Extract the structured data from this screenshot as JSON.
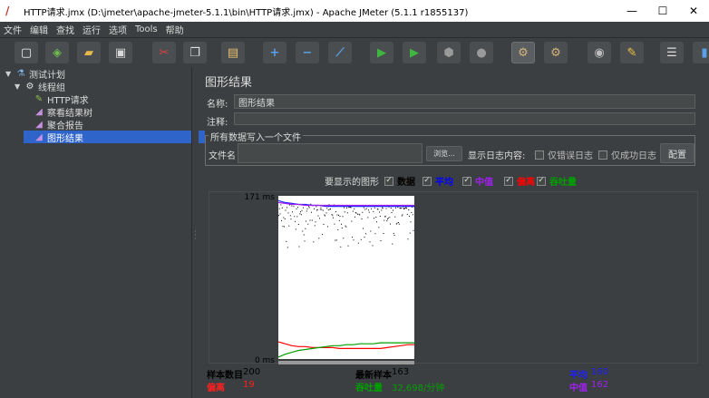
{
  "window": {
    "title": "HTTP请求.jmx (D:\\jmeter\\apache-jmeter-5.1.1\\bin\\HTTP请求.jmx) - Apache JMeter (5.1.1 r1855137)",
    "minimize": "—",
    "maximize": "☐",
    "close": "✕"
  },
  "menu": [
    "文件",
    "编辑",
    "查找",
    "运行",
    "选项",
    "Tools",
    "帮助"
  ],
  "toolbar": [
    {
      "name": "new-button",
      "glyph": "▢",
      "color": "#f0f0f0"
    },
    {
      "name": "templates-button",
      "glyph": "◈",
      "color": "#6fbf4f"
    },
    {
      "name": "open-button",
      "glyph": "▰",
      "color": "#e8b84a"
    },
    {
      "name": "save-button",
      "glyph": "▣",
      "color": "#d9d9d9"
    },
    {
      "name": "cut-button",
      "glyph": "✂",
      "color": "#e04040"
    },
    {
      "name": "copy-button",
      "glyph": "❐",
      "color": "#e0e0e0"
    },
    {
      "name": "paste-button",
      "glyph": "▤",
      "color": "#e8c070"
    },
    {
      "name": "expand-button",
      "glyph": "+",
      "color": "#5aa0e6"
    },
    {
      "name": "collapse-button",
      "glyph": "−",
      "color": "#5aa0e6"
    },
    {
      "name": "toggle-button",
      "glyph": "⟋",
      "color": "#5aa0e6"
    },
    {
      "name": "start-button",
      "glyph": "▶",
      "color": "#3fb63f"
    },
    {
      "name": "start-no-pauses-button",
      "glyph": "▶",
      "color": "#3fb63f"
    },
    {
      "name": "stop-button",
      "glyph": "⬢",
      "color": "#9a9a9a"
    },
    {
      "name": "shutdown-button",
      "glyph": "●",
      "color": "#9a9a9a"
    },
    {
      "name": "clear-button",
      "glyph": "⚙",
      "color": "#d4b47a"
    },
    {
      "name": "clear-all-button",
      "glyph": "⚙",
      "color": "#d4b47a"
    },
    {
      "name": "search-button",
      "glyph": "◉",
      "color": "#bdbdbd"
    },
    {
      "name": "reset-search-button",
      "glyph": "✎",
      "color": "#f0c040"
    },
    {
      "name": "function-helper-button",
      "glyph": "☰",
      "color": "#dcdcdc"
    },
    {
      "name": "help-button",
      "glyph": "▮",
      "color": "#5aa0e6"
    }
  ],
  "tree": [
    {
      "label": "测试计划",
      "icon": "flask-icon",
      "glyph": "⚗",
      "color": "#7fb3e6",
      "arrow": "▼",
      "indent": 0,
      "selected": false
    },
    {
      "label": "线程组",
      "icon": "gear-icon",
      "glyph": "⚙",
      "color": "#e0e0e0",
      "arrow": "▼",
      "indent": 1,
      "selected": false
    },
    {
      "label": "HTTP请求",
      "icon": "pipette-icon",
      "glyph": "✎",
      "color": "#8fbf4f",
      "arrow": "",
      "indent": 2,
      "selected": false
    },
    {
      "label": "察看结果树",
      "icon": "chart-icon",
      "glyph": "◢",
      "color": "#c890e0",
      "arrow": "",
      "indent": 2,
      "selected": false
    },
    {
      "label": "聚合报告",
      "icon": "chart-icon",
      "glyph": "◢",
      "color": "#c890e0",
      "arrow": "",
      "indent": 2,
      "selected": false
    },
    {
      "label": "图形结果",
      "icon": "chart-icon",
      "glyph": "◢",
      "color": "#c890e0",
      "arrow": "",
      "indent": 2,
      "selected": true
    }
  ],
  "panel": {
    "title": "图形结果",
    "name_label": "名称:",
    "name_value": "图形结果",
    "comment_label": "注释:",
    "comment_value": "",
    "group_title": "所有数据写入一个文件",
    "filename_label": "文件名",
    "filename_value": "",
    "browse_label": "浏览...",
    "log_label": "显示日志内容:",
    "errors_only_label": "仅错误日志",
    "success_only_label": "仅成功日志",
    "configure_label": "配置"
  },
  "graph_options": {
    "label": "要显示的图形",
    "items": [
      {
        "name": "data",
        "label": "数据",
        "color": "#000000",
        "checked": true
      },
      {
        "name": "average",
        "label": "平均",
        "color": "#0000ff",
        "checked": true
      },
      {
        "name": "median",
        "label": "中值",
        "color": "#a020f0",
        "checked": true
      },
      {
        "name": "deviation",
        "label": "偏离",
        "color": "#ff0000",
        "checked": true
      },
      {
        "name": "throughput",
        "label": "吞吐量",
        "color": "#00a000",
        "checked": true
      }
    ]
  },
  "chart_data": {
    "type": "line",
    "title": "",
    "xlabel": "",
    "ylabel": "",
    "y_max_label": "171  ms",
    "y_min_label": "0  ms",
    "ylim": [
      0,
      171
    ],
    "xlim": [
      0,
      200
    ],
    "grid": false,
    "series": [
      {
        "name": "平均",
        "color": "#2020ff",
        "x": [
          0,
          10,
          20,
          30,
          40,
          50,
          60,
          70,
          80,
          90,
          100,
          110,
          120,
          130,
          140,
          150,
          160,
          170,
          180,
          190,
          200
        ],
        "y": [
          166,
          164,
          163,
          162,
          162,
          161,
          161,
          160,
          160,
          160,
          160,
          160,
          160,
          160,
          160,
          160,
          160,
          160,
          160,
          160,
          160
        ]
      },
      {
        "name": "中值",
        "color": "#a020f0",
        "x": [
          0,
          10,
          20,
          30,
          40,
          50,
          60,
          70,
          80,
          90,
          100,
          110,
          120,
          130,
          140,
          150,
          160,
          170,
          180,
          190,
          200
        ],
        "y": [
          164,
          163,
          162,
          162,
          161,
          161,
          161,
          161,
          161,
          161,
          161,
          161,
          161,
          161,
          161,
          161,
          161,
          161,
          161,
          161,
          161
        ]
      },
      {
        "name": "偏离",
        "color": "#ff0000",
        "x": [
          0,
          10,
          20,
          30,
          40,
          50,
          60,
          70,
          80,
          90,
          100,
          110,
          120,
          130,
          140,
          150,
          160,
          170,
          180,
          190,
          200
        ],
        "y": [
          18,
          16,
          14,
          13,
          13,
          12,
          12,
          12,
          12,
          11,
          11,
          11,
          11,
          11,
          11,
          11,
          12,
          13,
          14,
          15,
          15
        ]
      },
      {
        "name": "吞吐量",
        "color": "#00a000",
        "x": [
          0,
          10,
          20,
          30,
          40,
          50,
          60,
          70,
          80,
          90,
          100,
          110,
          120,
          130,
          140,
          150,
          160,
          170,
          180,
          190,
          200
        ],
        "y": [
          2,
          5,
          7,
          9,
          10,
          11,
          12,
          13,
          14,
          14,
          15,
          15,
          16,
          16,
          16,
          17,
          17,
          17,
          17,
          17,
          17
        ]
      }
    ]
  },
  "stats": {
    "samples_label": "样本数目",
    "samples_value": "200",
    "latest_label": "最新样本",
    "latest_value": "163",
    "average_label": "平均",
    "average_value": "160",
    "deviation_label": "偏离",
    "deviation_value": "19",
    "throughput_label": "吞吐量",
    "throughput_value": "32,698/分钟",
    "median_label": "中值",
    "median_value": "162"
  },
  "colors": {
    "background": "#3c3f41",
    "selection": "#2f65ca",
    "data": "#000000",
    "average": "#0000ff",
    "median": "#a020f0",
    "deviation": "#ff0000",
    "throughput": "#00a000"
  }
}
